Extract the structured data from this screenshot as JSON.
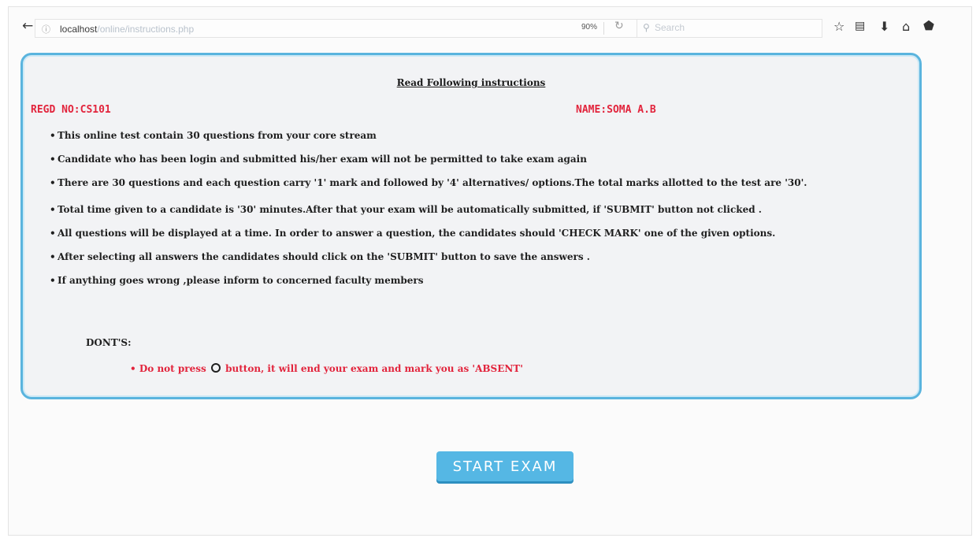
{
  "browser": {
    "url_host": "localhost",
    "url_path": "/online/instructions.php",
    "zoom": "90%",
    "search_placeholder": "Search"
  },
  "page": {
    "title": "Read Following instructions",
    "regd": "REGD NO:CS101",
    "name": "NAME:SOMA A.B",
    "rules": [
      "This online test contain 30 questions from your core stream",
      "Candidate who has been login and submitted his/her exam will not be permitted to take exam again",
      "There are 30 questions and each question carry '1' mark and followed by '4' alternatives/ options.The total marks allotted to the test are '30'.",
      "Total time given to a candidate is '30' minutes.After that your exam will be automatically submitted, if 'SUBMIT' button not clicked .",
      "All questions will be displayed at a time. In order to answer a question, the candidates should 'CHECK MARK' one of the given options.",
      "After selecting all answers the candidates should click on the 'SUBMIT' button to save the answers .",
      "If anything goes wrong ,please inform to concerned faculty members"
    ],
    "donts_heading": "DONT'S:",
    "donts_before": "Do not press",
    "donts_after": "button, it will end your exam and mark you as 'ABSENT'",
    "start_label": "START EXAM"
  },
  "colors": {
    "accent_red": "#e2243c",
    "panel_border": "#5ab4de",
    "button": "#55b7e4"
  },
  "icons": [
    "back-arrow-icon",
    "info-icon",
    "reload-icon",
    "search-icon",
    "bookmark-star-icon",
    "reading-list-icon",
    "download-icon",
    "home-icon",
    "pocket-icon",
    "reload-ring-icon"
  ]
}
